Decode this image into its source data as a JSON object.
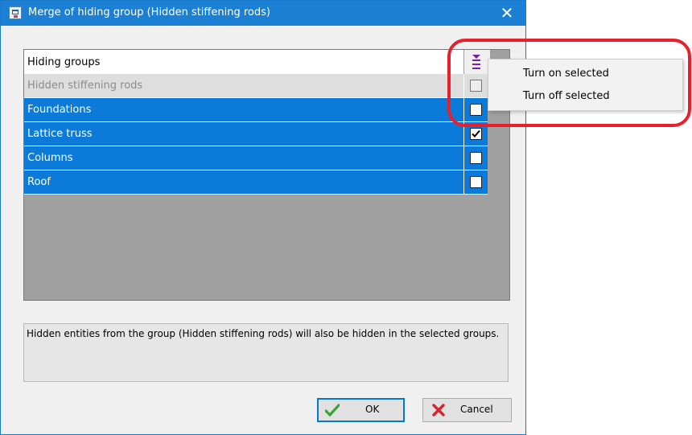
{
  "window": {
    "title": "Merge of hiding group (Hidden stiffening rods)",
    "close_glyph": "✕",
    "accent_color": "#1b7fd4",
    "app_icon": "app-icon"
  },
  "grid": {
    "header_label": "Hiding groups",
    "header_icon": "select-toggle-icon",
    "selection_color": "#0c7ad8",
    "rows": [
      {
        "label": "Hidden stiffening rods",
        "checked": false,
        "disabled": true
      },
      {
        "label": "Foundations",
        "checked": false,
        "disabled": false
      },
      {
        "label": "Lattice truss",
        "checked": true,
        "disabled": false
      },
      {
        "label": "Columns",
        "checked": false,
        "disabled": false
      },
      {
        "label": "Roof",
        "checked": false,
        "disabled": false
      }
    ]
  },
  "info": {
    "text": "Hidden entities from the group (Hidden stiffening rods) will also be hidden in the selected groups."
  },
  "buttons": {
    "ok_label": "OK",
    "ok_icon": "check-icon",
    "cancel_label": "Cancel",
    "cancel_icon": "x-icon"
  },
  "context_menu": {
    "items": [
      "Turn on selected",
      "Turn off selected"
    ]
  },
  "annotation": {
    "color": "#e8202c"
  }
}
